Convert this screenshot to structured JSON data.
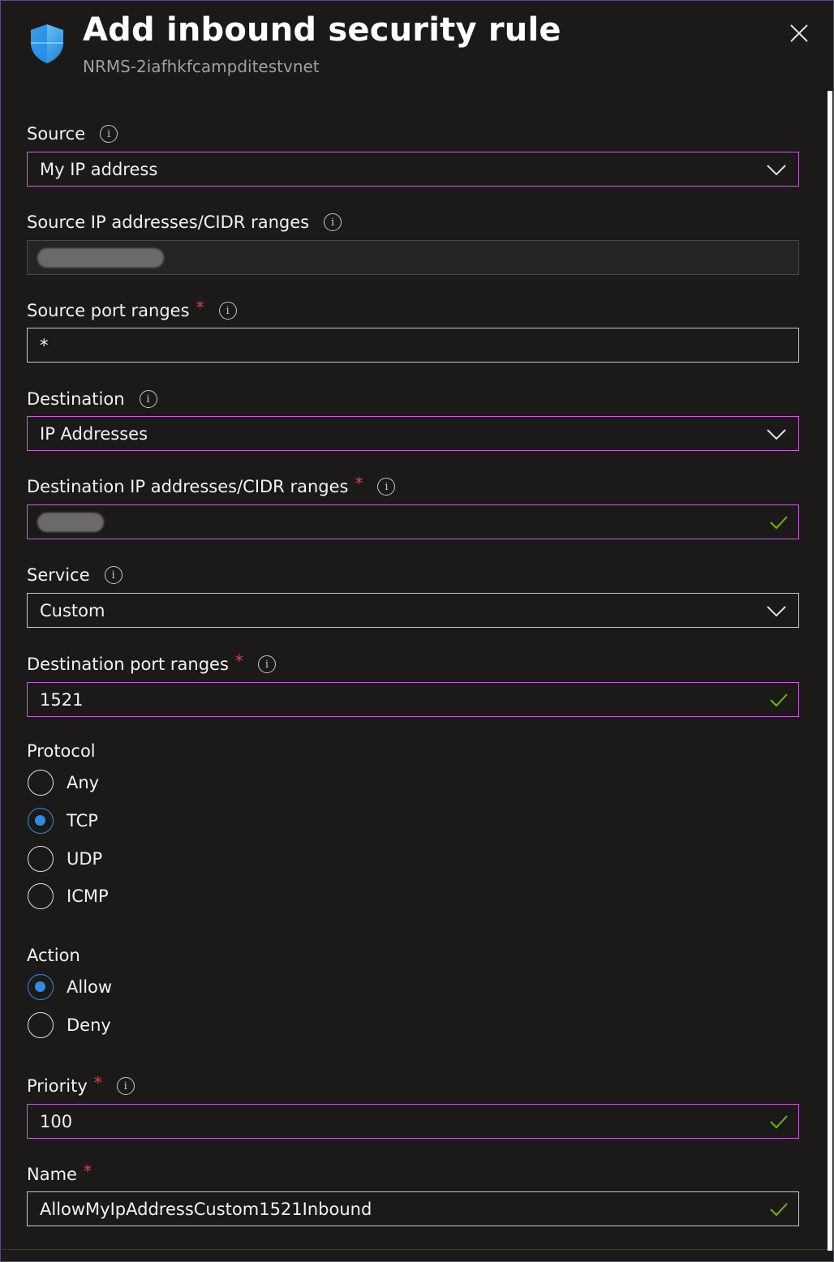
{
  "header": {
    "title": "Add inbound security rule",
    "subtitle": "NRMS-2iafhkfcampditestvnet"
  },
  "fields": {
    "source": {
      "label": "Source",
      "value": "My IP address"
    },
    "source_ips": {
      "label": "Source IP addresses/CIDR ranges"
    },
    "source_ports": {
      "label": "Source port ranges",
      "required": "*",
      "value": "*"
    },
    "destination": {
      "label": "Destination",
      "value": "IP Addresses"
    },
    "dest_ips": {
      "label": "Destination IP addresses/CIDR ranges",
      "required": "*"
    },
    "service": {
      "label": "Service",
      "value": "Custom"
    },
    "dest_ports": {
      "label": "Destination port ranges",
      "required": "*",
      "value": "1521"
    },
    "priority": {
      "label": "Priority",
      "required": "*",
      "value": "100"
    },
    "name": {
      "label": "Name",
      "required": "*",
      "value": "AllowMyIpAddressCustom1521Inbound"
    }
  },
  "protocol": {
    "label": "Protocol",
    "options": [
      "Any",
      "TCP",
      "UDP",
      "ICMP"
    ],
    "selected": "TCP"
  },
  "action": {
    "label": "Action",
    "options": [
      "Allow",
      "Deny"
    ],
    "selected": "Allow"
  },
  "icons": {
    "info": "info-icon",
    "close": "close-icon",
    "shield": "shield-icon",
    "chevron": "chevron-down-icon",
    "check": "checkmark-icon"
  },
  "colors": {
    "background": "#1b1a19",
    "accent_border": "#c561d6",
    "radio_selected": "#2f8be6",
    "required": "#e8403a",
    "valid_check": "#6bb700"
  }
}
